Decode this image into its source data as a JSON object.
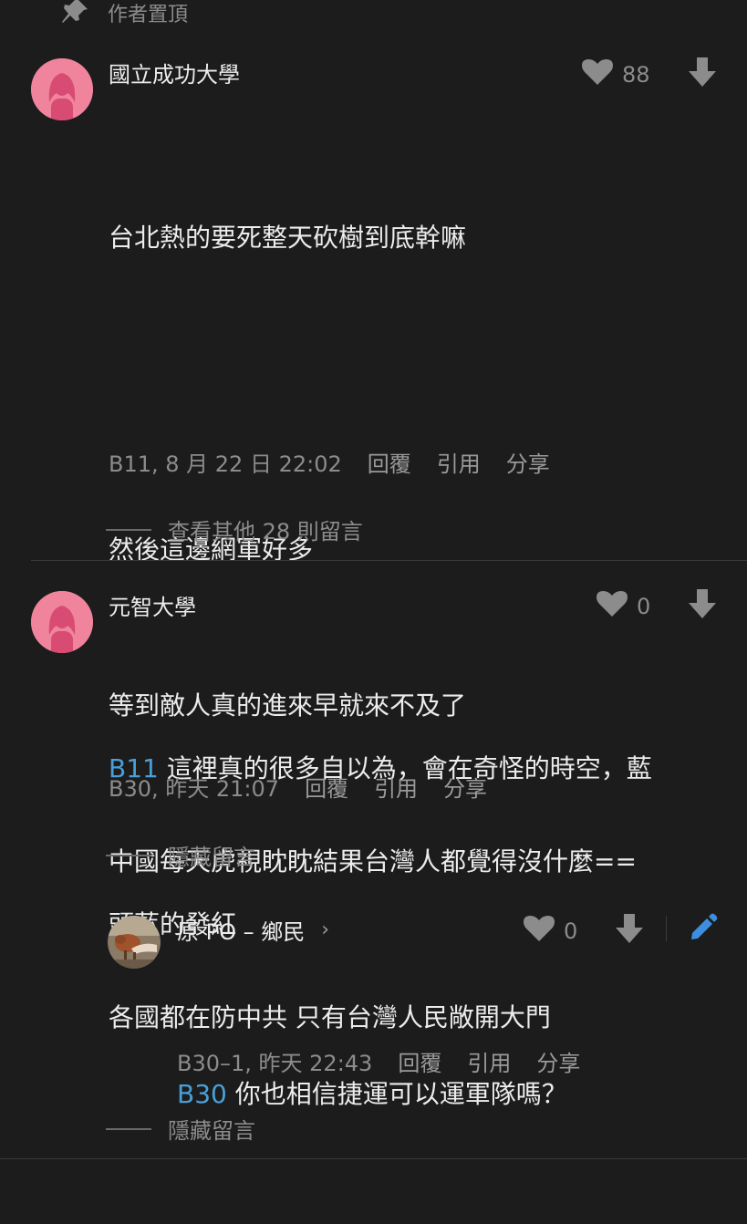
{
  "pinned_label": "作者置頂",
  "comments": [
    {
      "author": "國立成功大學",
      "likes": "88",
      "lines": [
        "台北熱的要死整天砍樹到底幹嘛",
        "",
        "然後這邊網軍好多",
        "等到敵人真的進來早就來不及了",
        "中國每天虎視眈眈結果台灣人都覺得沒什麼==",
        "各國都在防中共 只有台灣人民敞開大門"
      ],
      "stamp": "B11, 8 月 22 日 22:02",
      "actions": [
        "回覆",
        "引用",
        "分享"
      ],
      "thread_link": "查看其他 28 則留言"
    },
    {
      "author": "元智大學",
      "likes": "0",
      "mention": "B11",
      "text_line1": " 這裡真的很多自以為，會在奇怪的時空，藍",
      "text_line2": "頭藍的發紅",
      "stamp": "B30, 昨天 21:07",
      "actions": [
        "回覆",
        "引用",
        "分享"
      ],
      "thread_link": "隱藏留言"
    },
    {
      "author": "原 PO – 鄉民",
      "chevron": "›",
      "likes": "0",
      "mention": "B30",
      "text": " 你也相信捷運可以運軍隊嗎？",
      "stamp": "B30–1, 昨天 22:43",
      "actions": [
        "回覆",
        "引用",
        "分享"
      ],
      "thread_link": "隱藏留言"
    }
  ],
  "icons": {
    "pin": "pin-icon",
    "heart": "heart-icon",
    "down": "downvote-arrow-icon",
    "edit": "pencil-icon",
    "chevron": "chevron-right-icon"
  },
  "colors": {
    "background": "#1c1c1d",
    "mention": "#4a9fd8",
    "avatar": "#f0849c",
    "edit": "#3d8ee0"
  }
}
